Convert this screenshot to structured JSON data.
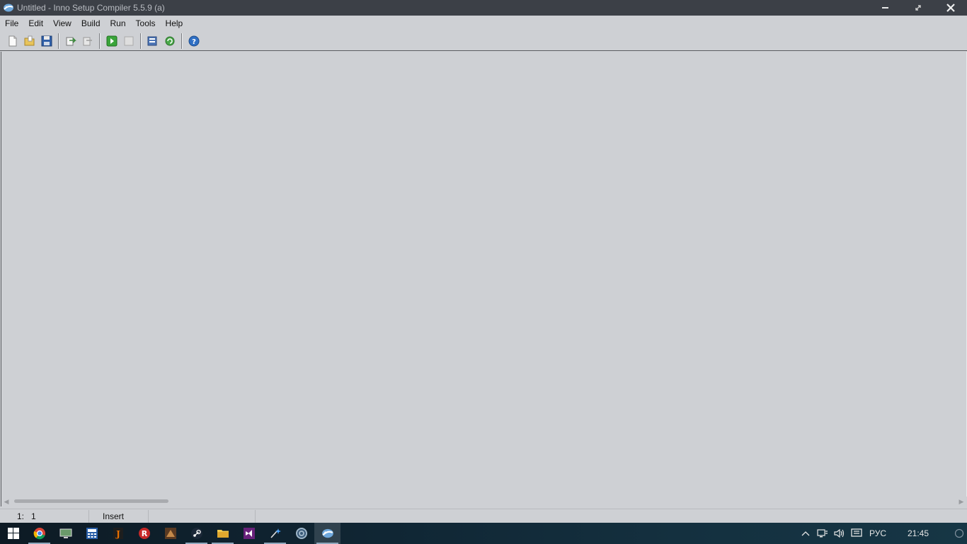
{
  "window": {
    "title": "Untitled - Inno Setup Compiler 5.5.9 (a)",
    "app_icon": "inno-setup-icon",
    "controls": {
      "minimize": "minimize-icon",
      "restore": "restore-icon",
      "close": "close-icon"
    }
  },
  "menu": {
    "items": [
      "File",
      "Edit",
      "View",
      "Build",
      "Run",
      "Tools",
      "Help"
    ]
  },
  "toolbar": {
    "buttons": [
      {
        "name": "new-file-icon"
      },
      {
        "name": "open-folder-icon"
      },
      {
        "name": "save-icon"
      },
      {
        "name": "compile-icon"
      },
      {
        "name": "stop-compile-icon"
      },
      {
        "name": "run-icon"
      },
      {
        "name": "terminate-icon"
      },
      {
        "name": "target-setup-icon"
      },
      {
        "name": "target-uninstall-icon"
      },
      {
        "name": "help-icon"
      }
    ]
  },
  "statusbar": {
    "position_line": "1:",
    "position_col": "1",
    "mode": "Insert"
  },
  "taskbar": {
    "apps": [
      "windows-start-icon",
      "chrome-icon",
      "monitor-app-icon",
      "calculator-app-icon",
      "java-icon",
      "r-app-icon",
      "game-icon",
      "steam-icon",
      "file-explorer-icon",
      "visual-studio-icon",
      "sparkle-app-icon",
      "browser-app-icon",
      "inno-setup-icon"
    ],
    "active_app": "inno-setup-icon",
    "language": "РУС",
    "time": "21:45"
  },
  "colors": {
    "titlebar": "#3c4047",
    "background": "#ced0d4",
    "taskbar": "#102634"
  }
}
